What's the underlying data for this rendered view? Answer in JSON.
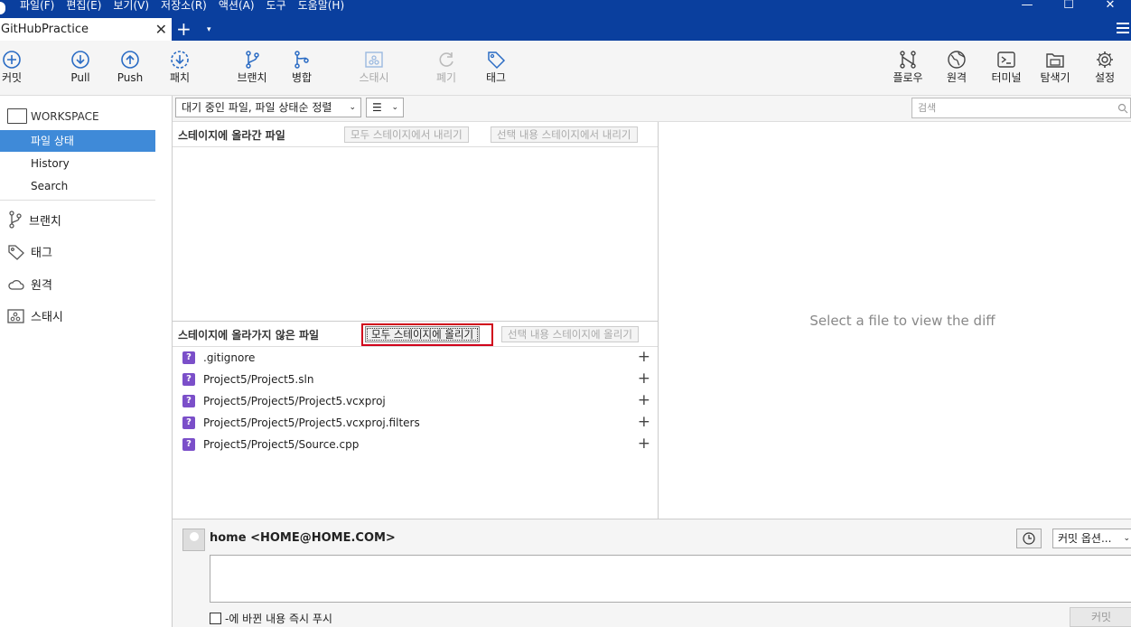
{
  "menubar": {
    "items": [
      "파일(F)",
      "편집(E)",
      "보기(V)",
      "저장소(R)",
      "액션(A)",
      "도구",
      "도움말(H)"
    ],
    "minimize": "—",
    "maximize": "☐",
    "close": "✕"
  },
  "tabbar": {
    "tab_title": "GitHubPractice",
    "tab_close": "✕",
    "new_tab": "+",
    "dropdown": "▾"
  },
  "toolbar": {
    "commit": "커밋",
    "pull": "Pull",
    "push": "Push",
    "patch": "패치",
    "branch": "브랜치",
    "merge": "병합",
    "stash": "스태시",
    "discard": "폐기",
    "tag": "태그",
    "flow": "플로우",
    "remote": "원격",
    "terminal": "터미널",
    "explorer": "탐색기",
    "settings": "설정"
  },
  "sidebar": {
    "workspace": "WORKSPACE",
    "items": [
      {
        "label": "파일 상태",
        "active": true
      },
      {
        "label": "History",
        "active": false
      },
      {
        "label": "Search",
        "active": false
      }
    ],
    "groups": {
      "branches": "브랜치",
      "tags": "태그",
      "remotes": "원격",
      "stashes": "스태시"
    }
  },
  "filterbar": {
    "sort_select": "대기 중인 파일, 파일 상태순 정렬",
    "view_select": "☰",
    "search_placeholder": "검색"
  },
  "staged": {
    "title": "스테이지에 올라간 파일",
    "unstage_all": "모두 스테이지에서 내리기",
    "unstage_selected": "선택 내용 스테이지에서 내리기"
  },
  "unstaged": {
    "title": "스테이지에 올라가지 않은 파일",
    "stage_all": "모두 스테이지에 올리기",
    "stage_selected": "선택 내용 스테이지에 올리기",
    "files": [
      {
        "name": ".gitignore",
        "status": "?"
      },
      {
        "name": "Project5/Project5.sln",
        "status": "?"
      },
      {
        "name": "Project5/Project5/Project5.vcxproj",
        "status": "?"
      },
      {
        "name": "Project5/Project5/Project5.vcxproj.filters",
        "status": "?"
      },
      {
        "name": "Project5/Project5/Source.cpp",
        "status": "?"
      }
    ]
  },
  "diff": {
    "placeholder": "Select a file to view the diff"
  },
  "commit": {
    "user": "home <HOME@HOME.COM>",
    "options": "커밋 옵션...",
    "push_checkbox_label": "-에 바뀐 내용 즉시 푸시",
    "commit_button": "커밋"
  },
  "colors": {
    "title_bar": "#0a3f9e",
    "sidebar_active": "#3f8ad8",
    "untracked_badge": "#7b4fc9",
    "highlight_box": "#d0021b"
  }
}
